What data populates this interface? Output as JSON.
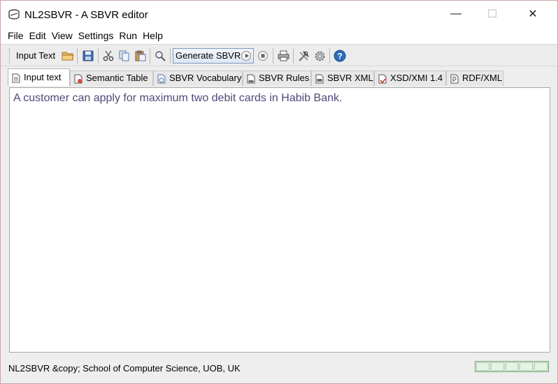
{
  "window": {
    "title": "NL2SBVR - A SBVR editor",
    "minimize": "—",
    "maximize": "☐",
    "close": "✕"
  },
  "menu": [
    "File",
    "Edit",
    "View",
    "Settings",
    "Run",
    "Help"
  ],
  "toolbar": {
    "input_label": "Input Text",
    "generate_label": "Generate SBVR",
    "icons": [
      "open-folder-icon",
      "save-icon",
      "cut-icon",
      "copy-icon",
      "paste-icon",
      "search-icon",
      "stop-icon",
      "print-icon",
      "tools-icon",
      "settings-gear-icon",
      "help-icon"
    ]
  },
  "tabs": [
    {
      "label": "Input text",
      "active": true
    },
    {
      "label": "Semantic Table"
    },
    {
      "label": "SBVR Vocabulary"
    },
    {
      "label": "SBVR Rules"
    },
    {
      "label": "SBVR XML"
    },
    {
      "label": "XSD/XMI 1.4"
    },
    {
      "label": "RDF/XML"
    }
  ],
  "editor": {
    "text": "A customer can apply for maximum two debit cards in Habib Bank."
  },
  "status": {
    "text": "NL2SBVR &copy; School of Computer Science, UOB, UK"
  },
  "colors": {
    "editor_text": "#4e4a7a",
    "progress_fill": "#cfe6cf",
    "window_border": "#c9a5a8"
  }
}
